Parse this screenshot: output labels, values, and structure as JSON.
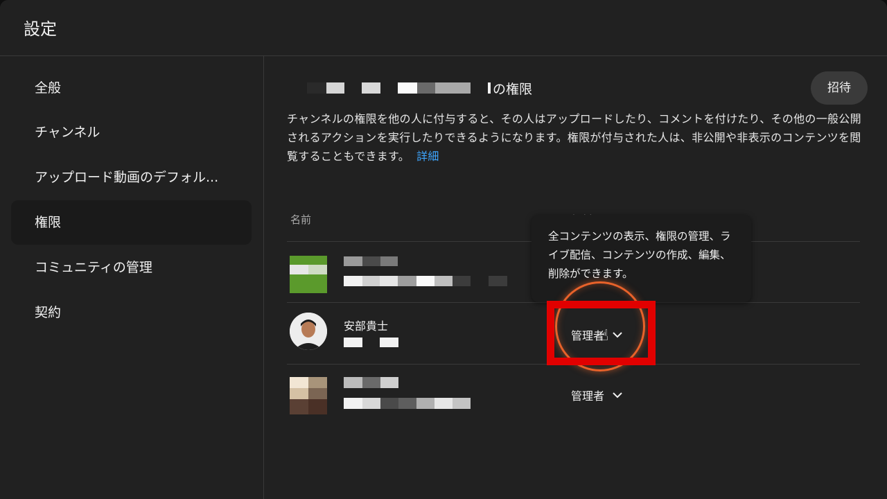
{
  "header": {
    "title": "設定"
  },
  "sidebar": {
    "items": [
      {
        "label": "全般",
        "active": false
      },
      {
        "label": "チャンネル",
        "active": false
      },
      {
        "label": "アップロード動画のデフォル...",
        "active": false
      },
      {
        "label": "権限",
        "active": true
      },
      {
        "label": "コミュニティの管理",
        "active": false
      },
      {
        "label": "契約",
        "active": false
      }
    ]
  },
  "main": {
    "title_suffix": "の権限",
    "invite_label": "招待",
    "description": "チャンネルの権限を他の人に付与すると、その人はアップロードしたり、コメントを付けたり、その他の一般公開されるアクションを実行したりできるようになります。権限が付与された人は、非公開や非表示のコンテンツを閲覧することもできます。",
    "details_link": "詳細",
    "columns": {
      "name": "名前",
      "role": "役割"
    },
    "rows": [
      {
        "name": "",
        "role": ""
      },
      {
        "name": "安部貴士",
        "role": "管理者"
      },
      {
        "name": "",
        "role": "管理者"
      }
    ]
  },
  "tooltip": {
    "text": "全コンテンツの表示、権限の管理、ライブ配信、コンテンツの作成、編集、削除ができます。"
  },
  "icons": {
    "dropdown": "chevron-down-icon",
    "cursor": "hand-pointer-icon"
  },
  "colors": {
    "link": "#3ea6ff",
    "highlight": "#e10000",
    "ring": "#e8622a"
  }
}
